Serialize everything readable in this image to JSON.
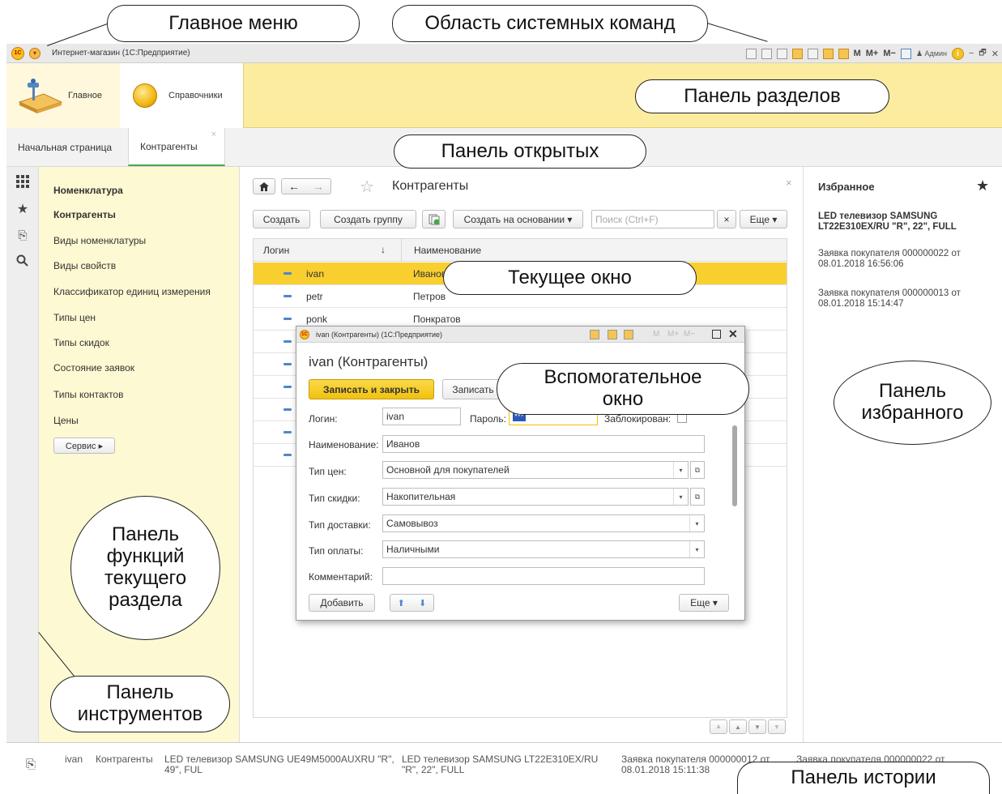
{
  "annotations": {
    "main_menu": "Главное меню",
    "system_commands": "Область системных команд",
    "sections_panel": "Панель разделов",
    "open_panel": "Панель открытых",
    "current_window": "Текущее окно",
    "aux_window_1": "Вспомогательное",
    "aux_window_2": "окно",
    "favorites_1": "Панель",
    "favorites_2": "избранного",
    "functions_1": "Панель",
    "functions_2": "функций",
    "functions_3": "текущего",
    "functions_4": "раздела",
    "tools_1": "Панель",
    "tools_2": "инструментов",
    "history": "Панель истории"
  },
  "titlebar": {
    "logo": "1С",
    "title": "Интернет-магазин  (1С:Предприятие)",
    "m": "M",
    "mplus": "M+",
    "mminus": "M−",
    "user": "♟ Админ",
    "info": "i",
    "minimize": "−",
    "restore": "🗗",
    "close": "✕"
  },
  "sections": {
    "items": [
      {
        "label": "Главное"
      },
      {
        "label": "Справочники"
      }
    ]
  },
  "tabs": {
    "items": [
      {
        "label": "Начальная страница"
      },
      {
        "label": "Контрагенты"
      }
    ],
    "close": "×"
  },
  "tools": {
    "icons": [
      "grid-icon",
      "star-icon",
      "history-icon",
      "search-icon"
    ]
  },
  "functions": {
    "items": [
      "Номенклатура",
      "Контрагенты",
      "Виды номенклатуры",
      "Виды свойств",
      "Классификатор единиц измерения",
      "Типы цен",
      "Типы скидок",
      "Состояние заявок",
      "Типы контактов",
      "Цены"
    ],
    "service": "Сервис ▸"
  },
  "current": {
    "title": "Контрагенты",
    "close": "×",
    "create": "Создать",
    "create_group": "Создать группу",
    "create_based": "Создать на основании ▾",
    "search_placeholder": "Поиск (Ctrl+F)",
    "clear": "×",
    "more": "Еще ▾",
    "col_login": "Логин",
    "col_sort": "↓",
    "col_name": "Наименование",
    "rows": [
      {
        "login": "ivan",
        "name": "Иванов"
      },
      {
        "login": "petr",
        "name": "Петров"
      },
      {
        "login": "ponk",
        "name": "Понкратов"
      }
    ]
  },
  "favorites": {
    "title": "Избранное",
    "star": "★",
    "items": [
      "LED телевизор SAMSUNG LT22E310EX/RU \"R\", 22\", FULL",
      "Заявка покупателя 000000022 от 08.01.2018 16:56:06",
      "Заявка покупателя 000000013 от 08.01.2018 15:14:47"
    ]
  },
  "history": {
    "items": [
      "ivan",
      "Контрагенты",
      "LED телевизор SAMSUNG UE49M5000AUXRU \"R\", 49\", FUL",
      "LED телевизор SAMSUNG LT22E310EX/RU \"R\", 22\", FULL",
      "Заявка покупателя 000000012 от 08.01.2018 15:11:38",
      "Заявка покупателя 000000022 от"
    ]
  },
  "dialog": {
    "window_title": "ivan (Контрагенты)  (1С:Предприятие)",
    "header": "ivan (Контрагенты)",
    "save_close": "Записать и закрыть",
    "save": "Записать",
    "login_label": "Логин:",
    "login_value": "ivan",
    "password_label": "Пароль:",
    "password_value": "***",
    "blocked_label": "Заблокирован:",
    "name_label": "Наименование:",
    "name_value": "Иванов",
    "price_type_label": "Тип цен:",
    "price_type_value": "Основной для покупателей",
    "discount_label": "Тип скидки:",
    "discount_value": "Накопительная",
    "delivery_label": "Тип доставки:",
    "delivery_value": "Самовывоз",
    "payment_label": "Тип оплаты:",
    "payment_value": "Наличными",
    "comment_label": "Комментарий:",
    "add": "Добавить",
    "more": "Еще ▾",
    "m": "M",
    "mplus": "M+",
    "mminus": "M−"
  }
}
